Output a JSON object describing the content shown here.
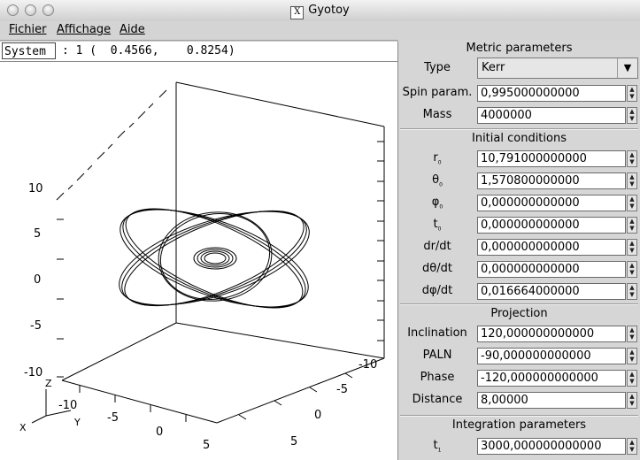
{
  "window": {
    "title": "Gyotoy"
  },
  "menubar": {
    "items": [
      "Fichier",
      "Affichage",
      "Aide"
    ]
  },
  "status": {
    "label": "System",
    "text": ": 1 (  0.4566,    0.8254)"
  },
  "plot": {
    "z_axis_ticks": [
      "10",
      "5",
      "0",
      "-5",
      "-10"
    ],
    "x_axis_ticks": [
      "-10",
      "-5",
      "0",
      "5"
    ],
    "y_axis_ticks": [
      "-10",
      "-5",
      "0",
      "5"
    ],
    "axis_labels": {
      "z": "Z",
      "y": "Y",
      "x": "X"
    }
  },
  "metric": {
    "title": "Metric parameters",
    "type_label": "Type",
    "type_value": "Kerr",
    "spin_label": "Spin param.",
    "spin_value": "0,995000000000",
    "mass_label": "Mass",
    "mass_value": "4000000"
  },
  "initial": {
    "title": "Initial conditions",
    "r0_label": "r",
    "r0_sub": "0",
    "r0_value": "10,791000000000",
    "theta0_label": "θ",
    "theta0_sub": "0",
    "theta0_value": "1,570800000000",
    "phi0_label": "φ",
    "phi0_sub": "0",
    "phi0_value": "0,000000000000",
    "t0_label": "t",
    "t0_sub": "0",
    "t0_value": "0,000000000000",
    "drdt_label": "dr/dt",
    "drdt_value": "0,000000000000",
    "dthetadt_label": "dθ/dt",
    "dthetadt_value": "0,000000000000",
    "dphidt_label": "dφ/dt",
    "dphidt_value": "0,016664000000"
  },
  "projection": {
    "title": "Projection",
    "incl_label": "Inclination",
    "incl_value": "120,000000000000",
    "paln_label": "PALN",
    "paln_value": "-90,000000000000",
    "phase_label": "Phase",
    "phase_value": "-120,000000000000",
    "dist_label": "Distance",
    "dist_value": "8,00000"
  },
  "integration": {
    "title": "Integration parameters",
    "t1_label": "t",
    "t1_sub": "1",
    "t1_value": "3000,000000000000"
  }
}
